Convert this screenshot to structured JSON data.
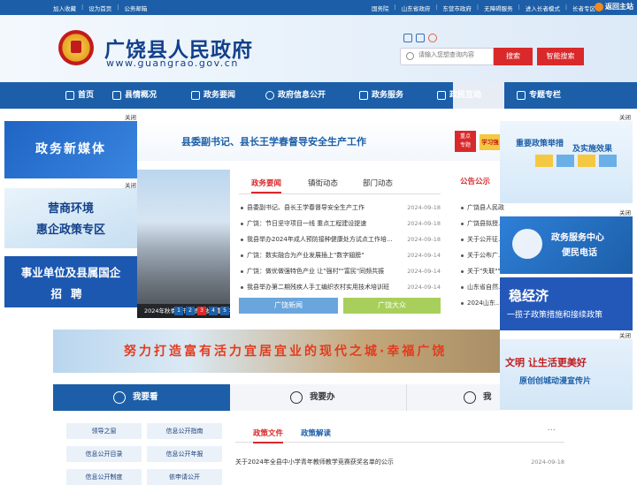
{
  "topbar": {
    "left_links": [
      "加入收藏",
      "设为首页",
      "公务邮箱"
    ],
    "right_links": [
      "国务院",
      "山东省政府",
      "东营市政府",
      "无障碍服务",
      "进入长者模式",
      "长者专区"
    ],
    "back_label": "返回主站"
  },
  "header": {
    "title": "广饶县人民政府",
    "url": "www.guangrao.gov.cn",
    "search_placeholder": "请输入您想查询内容",
    "search_label": "搜索",
    "smart_search_label": "智能搜索"
  },
  "nav": {
    "items": [
      "首页",
      "县情概况",
      "政务要闻",
      "政府信息公开",
      "政务服务",
      "政民互动",
      "专题专栏"
    ]
  },
  "close_label": "关闭",
  "left_banners": {
    "media": "政务新媒体",
    "env_line1": "营商环境",
    "env_line2": "惠企政策专区",
    "unit_line1": "事业单位及县属国企",
    "unit_line2": "招聘"
  },
  "headline": {
    "text": "县委副书记、县长王学春督导安全生产工作",
    "badge_line1": "重点",
    "badge_line2": "专题",
    "badge2": "学习强"
  },
  "photo": {
    "caption": "2024年秋季省市高质量发展重大项目",
    "pages": [
      "1",
      "2",
      "3",
      "4",
      "5"
    ],
    "active_page": "3"
  },
  "news": {
    "tabs": [
      "政务要闻",
      "镇街动态",
      "部门动态"
    ],
    "rows": [
      {
        "title": "县委副书记、县长王学春督导安全生产工作",
        "date": "2024-09-18"
      },
      {
        "title": "广饶：节日坚守项目一线 重点工程建设提速",
        "date": "2024-09-18"
      },
      {
        "title": "我县举办2024年成人预防接种健康处方试点工作培...",
        "date": "2024-09-18"
      },
      {
        "title": "广饶：数实融合为产业发展插上\"数字翅膀\"",
        "date": "2024-09-14"
      },
      {
        "title": "广饶：做优做强特色产业 让\"强村\"\"富民\"同频共振",
        "date": "2024-09-14"
      },
      {
        "title": "我县举办第二期残疾人手工编织农村实用技术培训班",
        "date": "2024-09-14"
      }
    ],
    "btn_news": "广饶新闻",
    "btn_public": "广饶大众"
  },
  "notices": {
    "title": "公告公示",
    "rows": [
      "广饶县人民政府关于...",
      "广饶县拟授...",
      "关于公开征...",
      "关于公布广...",
      "关于\"失联\"\"空壳\"地方金融组织名单",
      "山东省自然...",
      "2024山东..."
    ]
  },
  "right_banners": {
    "policy_line1": "重要政策举措",
    "policy_line2": "及实施效果",
    "hotline_line1": "政务服务中心",
    "hotline_line2": "便民电话",
    "steady_line1": "稳经济",
    "steady_line2": "一揽子政策措施和接续政策",
    "civil_line1": "文明 让生活更美好",
    "civil_line2": "原创创城动漫宣传片"
  },
  "slogan": "努力打造富有活力宜居宜业的现代之城·幸福广饶",
  "service_tabs": [
    "我要看",
    "我要办",
    "我"
  ],
  "side_menu": [
    "领导之窗",
    "信息公开指南",
    "信息公开目录",
    "信息公开年报",
    "信息公开制度",
    "依申请公开"
  ],
  "docs": {
    "tabs": [
      "政策文件",
      "政策解读"
    ],
    "more": "···",
    "rows": [
      {
        "title": "关于2024年全县中小学青年教师教学竞赛获奖名单的公示",
        "date": "2024-09-18"
      }
    ]
  },
  "colors": {
    "primary": "#1c5fa8",
    "accent_red": "#d9292b",
    "badge_yellow": "#f5c842"
  }
}
